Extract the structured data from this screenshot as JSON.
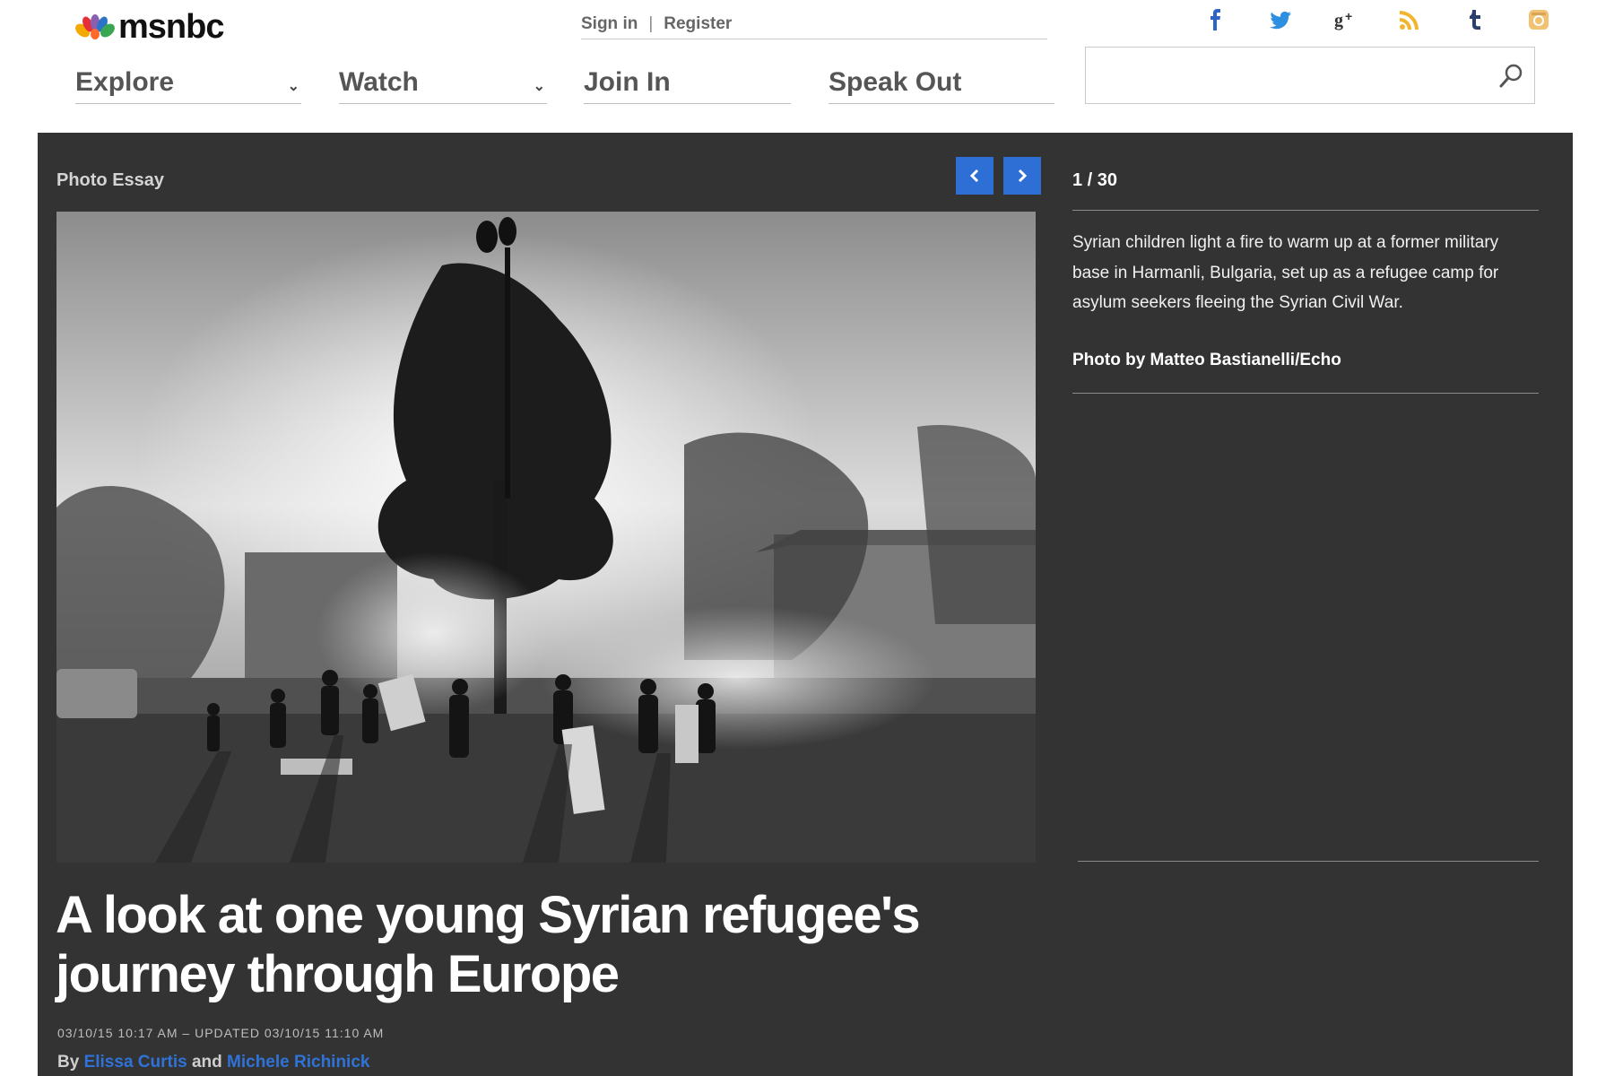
{
  "brand": {
    "logo_text": "msnbc"
  },
  "account": {
    "sign_in": "Sign in",
    "separator": "|",
    "register": "Register"
  },
  "nav": [
    {
      "label": "Explore",
      "has_dropdown": true
    },
    {
      "label": "Watch",
      "has_dropdown": true
    },
    {
      "label": "Join In",
      "has_dropdown": false
    },
    {
      "label": "Speak Out",
      "has_dropdown": false
    }
  ],
  "social": [
    {
      "icon": "facebook-icon",
      "color": "#2f63c4"
    },
    {
      "icon": "twitter-icon",
      "color": "#2c8fe0"
    },
    {
      "icon": "google-plus-icon",
      "color": "#333333"
    },
    {
      "icon": "rss-icon",
      "color": "#f2b531"
    },
    {
      "icon": "tumblr-icon",
      "color": "#2b3f6e"
    },
    {
      "icon": "instagram-icon",
      "color": "#f0c272"
    }
  ],
  "search": {
    "placeholder": "",
    "value": ""
  },
  "gallery": {
    "kicker": "Photo Essay",
    "counter": "1 / 30",
    "caption": "Syrian children light a fire to warm up at a former military base in Harmanli, Bulgaria, set up as a refugee camp for asylum seekers fleeing the Syrian Civil War.",
    "credit": "Photo by Matteo Bastianelli/Echo",
    "prev_icon": "chevron-left-icon",
    "next_icon": "chevron-right-icon"
  },
  "article": {
    "headline": "A look at one young Syrian refugee's journey through Europe",
    "dateline": "03/10/15 10:17 AM – UPDATED 03/10/15 11:10 AM",
    "by": "By",
    "author1": "Elissa Curtis",
    "and": "and",
    "author2": "Michele Richinick"
  },
  "colors": {
    "panel": "#333333",
    "accent": "#2e6fd6",
    "link": "#2f73d8"
  }
}
